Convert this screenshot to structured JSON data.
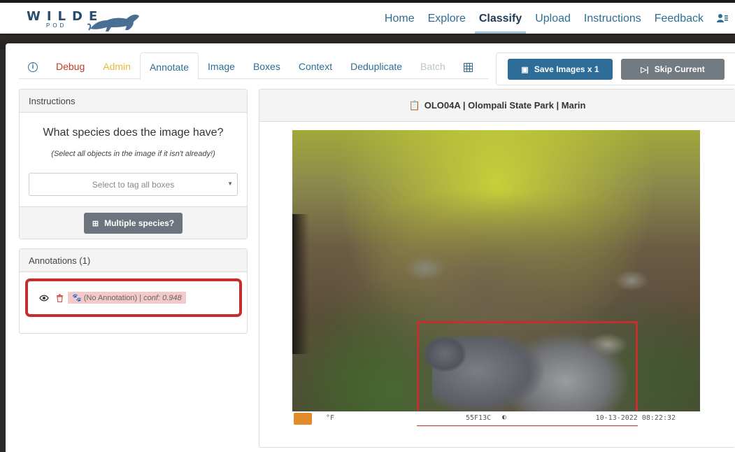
{
  "brand": {
    "name": "WILDE",
    "sub": "POD"
  },
  "nav": {
    "items": [
      {
        "label": "Home",
        "active": false
      },
      {
        "label": "Explore",
        "active": false
      },
      {
        "label": "Classify",
        "active": true
      },
      {
        "label": "Upload",
        "active": false
      },
      {
        "label": "Instructions",
        "active": false
      },
      {
        "label": "Feedback",
        "active": false
      }
    ],
    "user_icon": "user-card-icon"
  },
  "tabs": {
    "info_icon": "info-icon",
    "items": [
      {
        "label": "Debug"
      },
      {
        "label": "Admin"
      },
      {
        "label": "Annotate"
      },
      {
        "label": "Image"
      },
      {
        "label": "Boxes"
      },
      {
        "label": "Context"
      },
      {
        "label": "Deduplicate"
      },
      {
        "label": "Batch"
      }
    ],
    "grid_icon": "grid-icon"
  },
  "actions": {
    "save_label": "Save Images x 1",
    "skip_label": "Skip Current"
  },
  "instructions": {
    "header": "Instructions",
    "question": "What species does the image have?",
    "note": "(Select all objects in the image if it isn't already!)",
    "select_placeholder": "Select to tag all boxes",
    "multiple_label": "Multiple species?"
  },
  "annotations": {
    "header": "Annotations (1)",
    "items": [
      {
        "label": "(No Annotation) | ",
        "conf": "conf: 0.948"
      }
    ]
  },
  "image": {
    "title": "OLO04A | Olompali State Park | Marin",
    "strip": {
      "temp": "°F",
      "code": "55F13C",
      "date": "10-13-2022 08:22:32"
    }
  },
  "colors": {
    "accent": "#2c6f93",
    "save": "#2e6d97",
    "skip": "#737b82",
    "bbox": "#c62d2d",
    "debug": "#c0392b",
    "admin": "#e5b93a"
  }
}
